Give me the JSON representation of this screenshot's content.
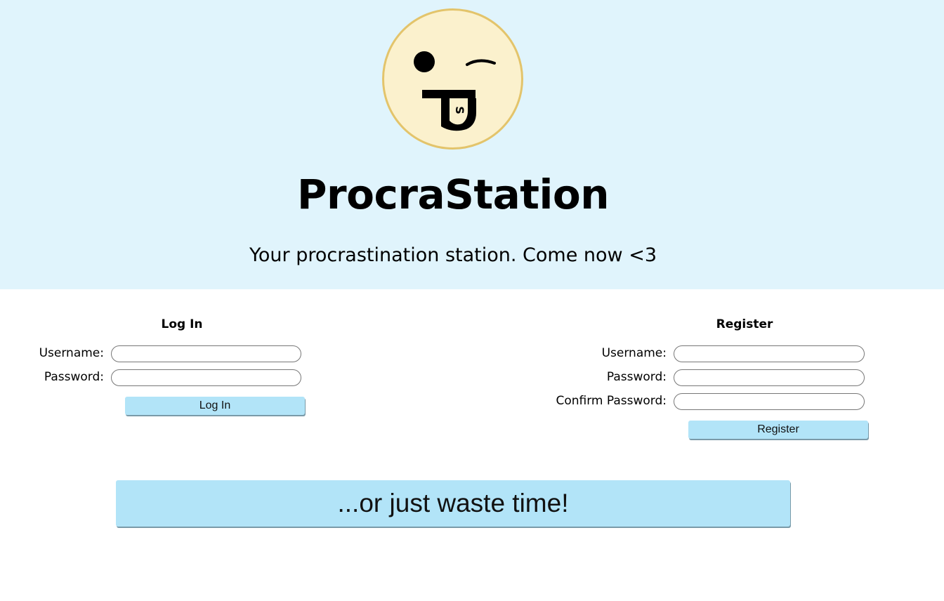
{
  "header": {
    "title": "ProcraStation",
    "tagline": "Your procrastination station. Come now <3",
    "logo": {
      "icon": "winking-tongue-face-icon",
      "tongue_letter": "S",
      "face_color": "#fbf1cd",
      "outline_color": "#e3c46b"
    }
  },
  "login": {
    "heading": "Log In",
    "username_label": "Username:",
    "username_value": "",
    "password_label": "Password:",
    "password_value": "",
    "submit_label": "Log In"
  },
  "register": {
    "heading": "Register",
    "username_label": "Username:",
    "username_value": "",
    "password_label": "Password:",
    "password_value": "",
    "confirm_label": "Confirm Password:",
    "confirm_value": "",
    "submit_label": "Register"
  },
  "guest": {
    "label": "...or just waste time!"
  },
  "colors": {
    "hero_bg": "#e0f4fc",
    "button_bg": "#b2e4f8"
  }
}
